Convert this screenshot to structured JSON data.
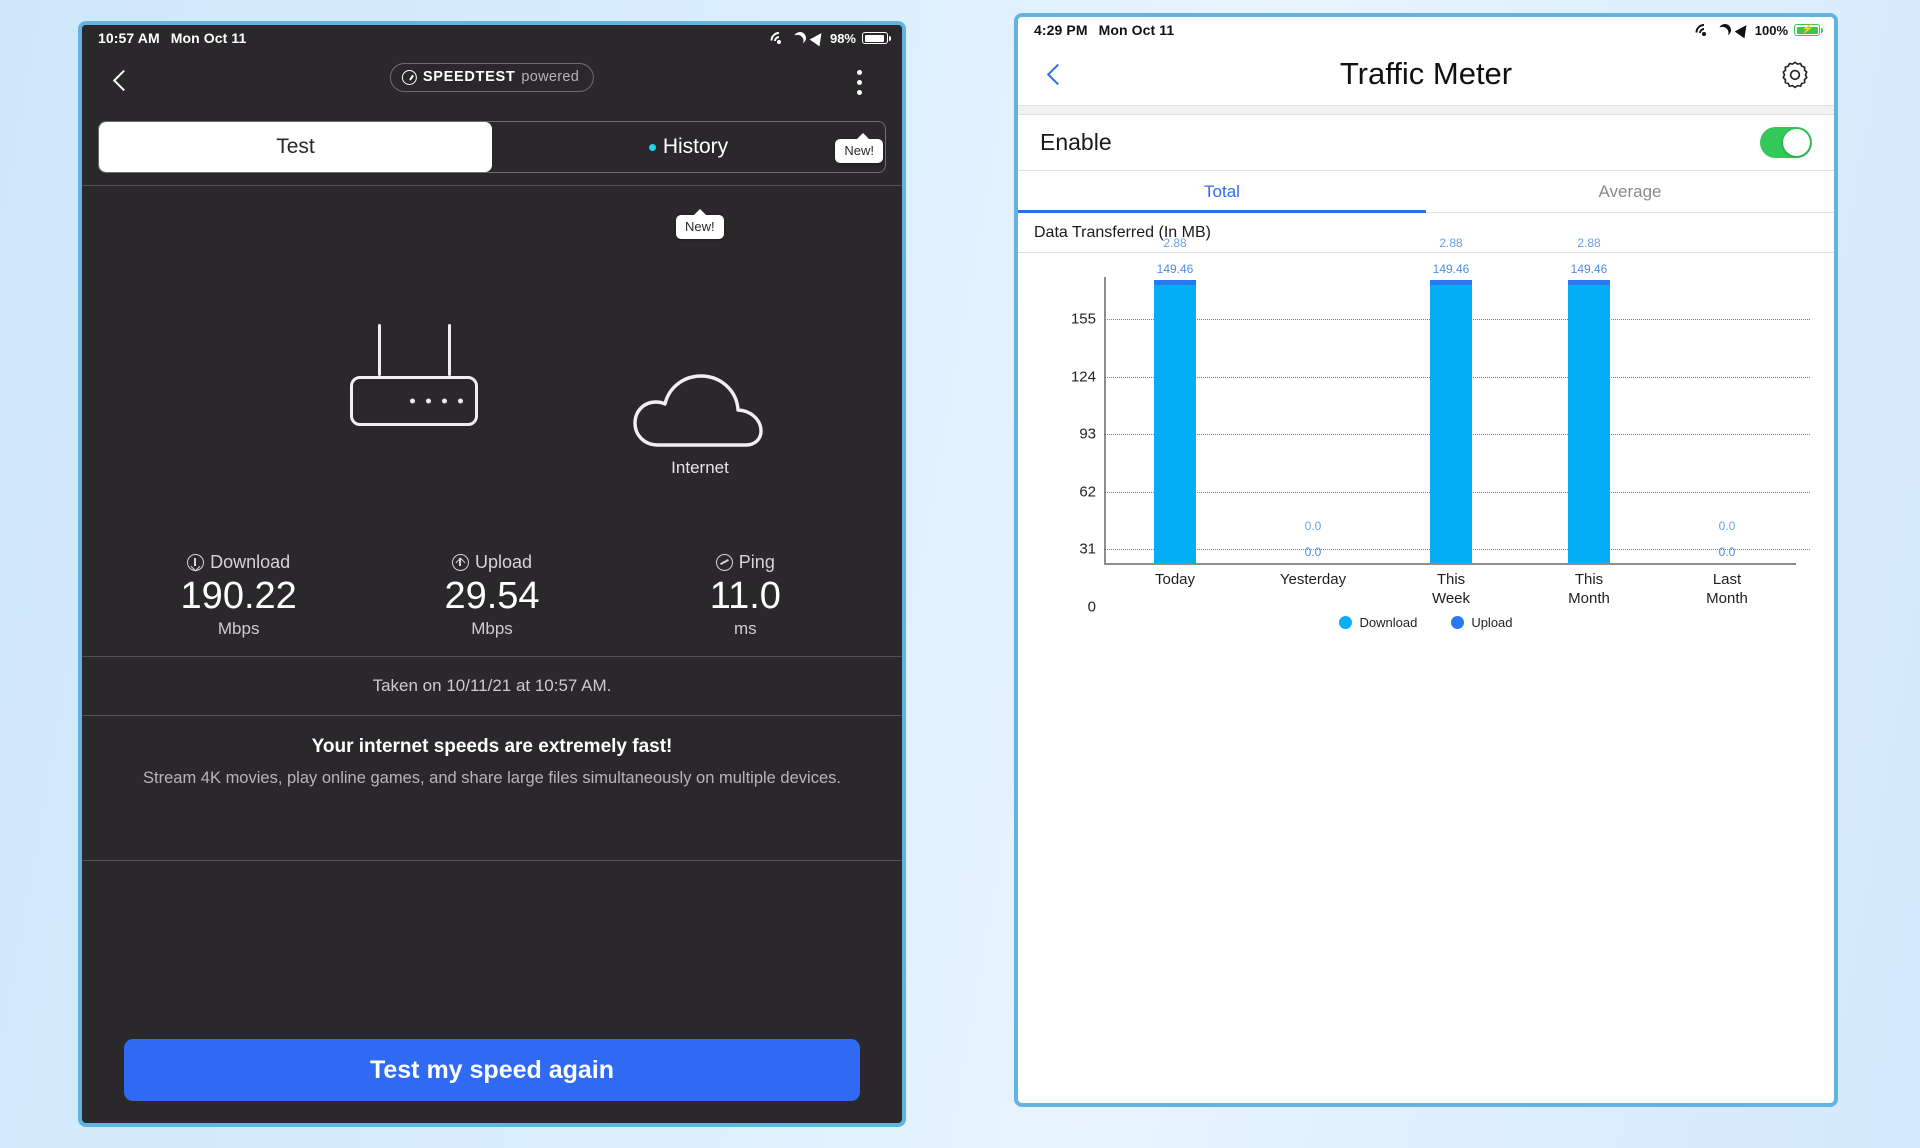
{
  "left_panel": {
    "status_bar": {
      "time": "10:57 AM",
      "date": "Mon Oct 11",
      "battery": "98%",
      "icons": [
        "wifi-icon",
        "moon-icon",
        "location-arrow-icon",
        "battery-icon"
      ]
    },
    "header": {
      "back_icon": "chevron-left-icon",
      "logo_brand": "SPEEDTEST",
      "logo_suffix": "powered",
      "menu_icon": "overflow-menu-icon",
      "menu_tooltip": "New!"
    },
    "tabs": [
      {
        "label": "Test",
        "active": true,
        "badge": false
      },
      {
        "label": "History",
        "active": false,
        "badge": true
      }
    ],
    "history_tooltip": "New!",
    "diagram": {
      "router_icon": "router-icon",
      "cloud_icon": "cloud-icon",
      "cloud_label": "Internet"
    },
    "metrics": [
      {
        "label": "Download",
        "value": "190.22",
        "unit": "Mbps",
        "icon": "download-arrow-icon"
      },
      {
        "label": "Upload",
        "value": "29.54",
        "unit": "Mbps",
        "icon": "upload-arrow-icon"
      },
      {
        "label": "Ping",
        "value": "11.0",
        "unit": "ms",
        "icon": "ping-icon"
      }
    ],
    "taken_on": "Taken on 10/11/21 at 10:57 AM.",
    "advice_title": "Your internet speeds are extremely fast!",
    "advice_body": "Stream 4K movies, play online games, and share large files simultaneously on multiple devices.",
    "cta_label": "Test my speed again",
    "colors": {
      "background": "#2b282c",
      "cta": "#2f6bf2",
      "badge": "#23d5e5"
    }
  },
  "right_panel": {
    "status_bar": {
      "time": "4:29 PM",
      "date": "Mon Oct 11",
      "battery": "100%",
      "icons": [
        "wifi-icon",
        "moon-icon",
        "location-arrow-icon",
        "battery-charging-icon"
      ]
    },
    "header": {
      "title": "Traffic Meter",
      "back_icon": "chevron-left-icon",
      "settings_icon": "gear-icon"
    },
    "enable_row": {
      "label": "Enable",
      "toggle_on": true
    },
    "tabs": [
      {
        "label": "Total",
        "active": true
      },
      {
        "label": "Average",
        "active": false
      }
    ],
    "section_title": "Data Transferred (In MB)",
    "colors": {
      "accent": "#2f6bf2",
      "toggle_on": "#34c759",
      "download": "#06aef8",
      "upload": "#2979f0"
    }
  },
  "chart_data": {
    "type": "bar",
    "stacked": true,
    "title": "Data Transferred (In MB)",
    "xlabel": "",
    "ylabel": "",
    "ylim": [
      0,
      155
    ],
    "yticks": [
      0,
      31,
      62,
      93,
      124,
      155
    ],
    "ytick_labels": [
      "0",
      "31",
      "62",
      "93",
      "124",
      "155"
    ],
    "grid": true,
    "legend_position": "bottom",
    "categories": [
      "Today",
      "Yesterday",
      "This Week",
      "This Month",
      "Last Month"
    ],
    "series": [
      {
        "name": "Download",
        "color": "#06aef8",
        "values": [
          149.46,
          0.0,
          149.46,
          149.46,
          0.0
        ],
        "labels": [
          "149.46",
          "0.0",
          "149.46",
          "149.46",
          "0.0"
        ]
      },
      {
        "name": "Upload",
        "color": "#2979f0",
        "values": [
          2.88,
          0.0,
          2.88,
          2.88,
          0.0
        ],
        "labels": [
          "2.88",
          "0.0",
          "2.88",
          "2.88",
          "0.0"
        ]
      }
    ]
  }
}
